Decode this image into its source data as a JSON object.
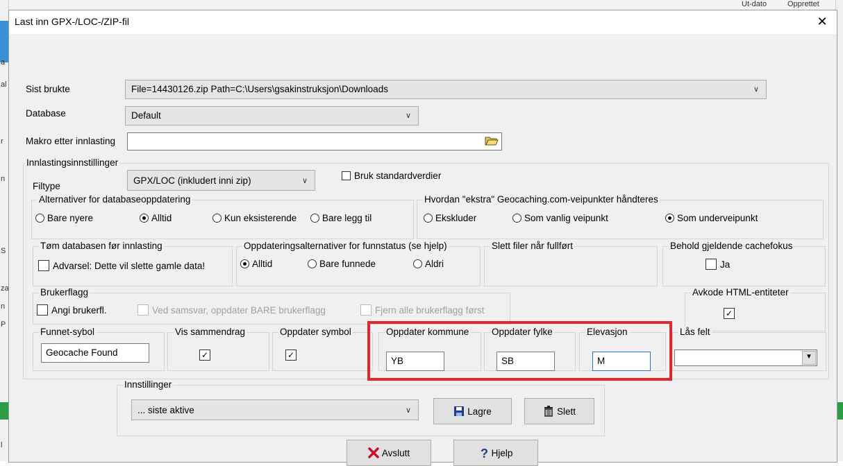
{
  "dialog": {
    "title": "Last inn GPX-/LOC-/ZIP-fil",
    "close_glyph": "✕"
  },
  "background": {
    "top_right_1": "Ut-dato",
    "top_right_2": "Opprettet",
    "left_chars": [
      "a",
      "al",
      "r",
      "n",
      "S",
      "za",
      "n",
      "P",
      "l"
    ]
  },
  "sist_brukte": {
    "label": "Sist brukte",
    "value": "File=14430126.zip Path=C:\\Users\\gsakinstruksjon\\Downloads"
  },
  "database": {
    "label": "Database",
    "value": "Default"
  },
  "makro": {
    "label": "Makro etter innlasting",
    "value": "",
    "icon": "folder-open-icon"
  },
  "innlasting": {
    "legend": "Innlastingsinnstillinger",
    "filtype_label": "Filtype",
    "filtype_value": "GPX/LOC (inkludert inni zip)",
    "standard_label": "Bruk standardverdier",
    "standard_checked": false
  },
  "alternativer": {
    "legend": "Alternativer for databaseoppdatering",
    "options": [
      "Bare nyere",
      "Alltid",
      "Kun eksisterende",
      "Bare legg til"
    ],
    "selected": "Alltid"
  },
  "ekstra": {
    "legend": "Hvordan \"ekstra\" Geocaching.com-veipunkter håndteres",
    "options": [
      "Ekskluder",
      "Som vanlig veipunkt",
      "Som underveipunkt"
    ],
    "selected": "Som underveipunkt"
  },
  "tom": {
    "legend": "Tøm databasen før innlasting",
    "check_label": "Advarsel: Dette vil slette gamle data!",
    "checked": false
  },
  "funnstatus": {
    "legend": "Oppdateringsalternativer for funnstatus (se hjelp)",
    "options": [
      "Alltid",
      "Bare funnede",
      "Aldri"
    ],
    "selected": "Alltid"
  },
  "slett_filer": {
    "legend": "Slett filer når fullført"
  },
  "behold": {
    "legend": "Behold gjeldende cachefokus",
    "check_label": "Ja",
    "checked": false
  },
  "brukerflagg": {
    "legend": "Brukerflagg",
    "angi_label": "Angi brukerfl.",
    "ved_samsvar_label": "Ved samsvar, oppdater BARE brukerflagg",
    "fjern_label": "Fjern alle brukerflagg først"
  },
  "avkode": {
    "legend": "Avkode HTML-entiteter",
    "checked": true
  },
  "funnet": {
    "legend": "Funnet-sybol",
    "value": "Geocache Found"
  },
  "vis_sammendrag": {
    "legend": "Vis sammendrag",
    "checked": true
  },
  "oppdater_symbol": {
    "legend": "Oppdater symbol",
    "checked": true
  },
  "kommune": {
    "legend": "Oppdater kommune",
    "value": "YB"
  },
  "fylke": {
    "legend": "Oppdater fylke",
    "value": "SB"
  },
  "elevasjon": {
    "legend": "Elevasjon",
    "value": "M"
  },
  "las_felt": {
    "legend": "Lås felt",
    "value": ""
  },
  "innstillinger": {
    "legend": "Innstillinger",
    "value": "... siste aktive",
    "lagre_label": "Lagre",
    "slett_label": "Slett"
  },
  "buttons": {
    "avslutt_label": "Avslutt",
    "hjelp_label": "Hjelp"
  },
  "colors": {
    "highlight": "#e0262f",
    "dialog_bg": "#f0f0f0"
  }
}
